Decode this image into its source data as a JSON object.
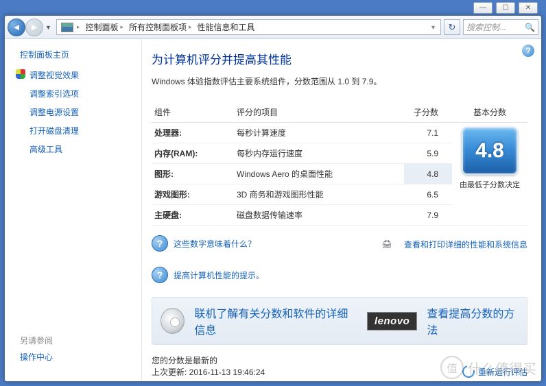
{
  "chrome": {
    "min": "—",
    "max": "☐",
    "close": "✕"
  },
  "nav": {
    "crumbs": [
      "控制面板",
      "所有控制面板项",
      "性能信息和工具"
    ],
    "search_placeholder": "搜索控制..."
  },
  "sidebar": {
    "header": "控制面板主页",
    "links": [
      "调整视觉效果",
      "调整索引选项",
      "调整电源设置",
      "打开磁盘清理",
      "高级工具"
    ],
    "seealso_hdr": "另请参阅",
    "seealso": [
      "操作中心"
    ]
  },
  "main": {
    "title": "为计算机评分并提高其性能",
    "desc": "Windows 体验指数评估主要系统组件，分数范围从 1.0 到 7.9。",
    "cols": {
      "component": "组件",
      "item": "评分的项目",
      "sub": "子分数",
      "base": "基本分数"
    },
    "rows": [
      {
        "comp": "处理器:",
        "item": "每秒计算速度",
        "sub": "7.1",
        "hi": false
      },
      {
        "comp": "内存(RAM):",
        "item": "每秒内存运行速度",
        "sub": "5.9",
        "hi": false
      },
      {
        "comp": "图形:",
        "item": "Windows Aero 的桌面性能",
        "sub": "4.8",
        "hi": true
      },
      {
        "comp": "游戏图形:",
        "item": "3D 商务和游戏图形性能",
        "sub": "6.5",
        "hi": false
      },
      {
        "comp": "主硬盘:",
        "item": "磁盘数据传输速率",
        "sub": "7.9",
        "hi": false
      }
    ],
    "base_score": "4.8",
    "base_label": "由最低子分数决定",
    "help1": "这些数字意味着什么？",
    "help2": "提高计算机性能的提示。",
    "print_link": "查看和打印详细的性能和系统信息",
    "sw_link": "联机了解有关分数和软件的详细信息",
    "vendor": "lenovo",
    "vendor_link": "查看提高分数的方法",
    "status1": "您的分数是最新的",
    "status2": "上次更新: 2016-11-13 19:46:24",
    "rerun": "重新运行评估"
  },
  "watermark": "什么值得买"
}
